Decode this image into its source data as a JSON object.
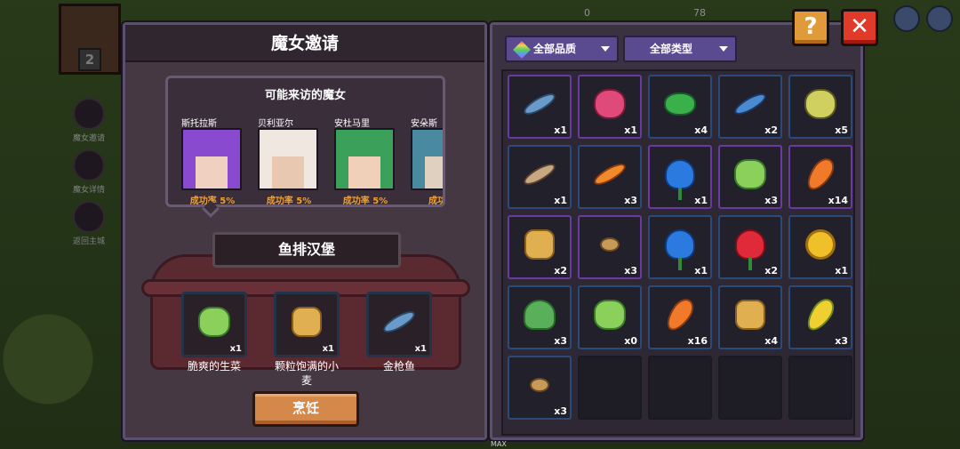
{
  "window": {
    "title": "魔女邀请"
  },
  "side_menu": [
    {
      "label": "魔女邀请",
      "icon": "heart-icon"
    },
    {
      "label": "魔女详情",
      "icon": "gift-icon"
    },
    {
      "label": "返回主城",
      "icon": "castle-icon"
    }
  ],
  "house_number": "2",
  "resources": {
    "count_a": "0",
    "count_b": "78"
  },
  "witch_section": {
    "title": "可能来访的魔女",
    "witches": [
      {
        "name": "斯托拉斯",
        "rate": "成功率 5%",
        "hair": "#8a4ad0",
        "skin": "#f0d0c0"
      },
      {
        "name": "贝利亚尔",
        "rate": "成功率 5%",
        "hair": "#f0e8e0",
        "skin": "#e8c8b0"
      },
      {
        "name": "安杜马里",
        "rate": "成功率 5%",
        "hair": "#3aa05a",
        "skin": "#f0d0b8"
      },
      {
        "name": "安朵斯",
        "rate": "成功率",
        "hair": "#4a8aa0",
        "skin": "#e0d0c0"
      }
    ]
  },
  "dish": {
    "name": "鱼排汉堡"
  },
  "ingredients": [
    {
      "label": "脆爽的生菜",
      "count": "x1",
      "icon": "lettuce-icon"
    },
    {
      "label": "颗粒饱满的小麦",
      "count": "x1",
      "icon": "wheat-icon"
    },
    {
      "label": "金枪鱼",
      "count": "x1",
      "icon": "tuna-icon"
    }
  ],
  "cook_button": {
    "label": "烹饪"
  },
  "filters": {
    "quality": "全部品质",
    "type": "全部类型"
  },
  "inventory": [
    {
      "icon": "tuna-icon",
      "count": "x1",
      "quality": "purple"
    },
    {
      "icon": "octopus-icon",
      "count": "x1",
      "quality": "purple"
    },
    {
      "icon": "frog-icon",
      "count": "x4",
      "quality": "blue"
    },
    {
      "icon": "blue-fish-icon",
      "count": "x2",
      "quality": "blue"
    },
    {
      "icon": "pufferfish-icon",
      "count": "x5",
      "quality": "blue"
    },
    {
      "icon": "catfish-icon",
      "count": "x1",
      "quality": "blue"
    },
    {
      "icon": "goldfish-icon",
      "count": "x3",
      "quality": "blue"
    },
    {
      "icon": "blue-rose-icon",
      "count": "x1",
      "quality": "purple"
    },
    {
      "icon": "lettuce-icon",
      "count": "x3",
      "quality": "purple"
    },
    {
      "icon": "carrot-icon",
      "count": "x14",
      "quality": "purple"
    },
    {
      "icon": "wheat-icon",
      "count": "x2",
      "quality": "purple"
    },
    {
      "icon": "potato-icon",
      "count": "x3",
      "quality": "purple"
    },
    {
      "icon": "blue-rose-icon",
      "count": "x1",
      "quality": "blue"
    },
    {
      "icon": "red-rose-icon",
      "count": "x2",
      "quality": "blue"
    },
    {
      "icon": "sunflower-icon",
      "count": "x1",
      "quality": "blue"
    },
    {
      "icon": "bok-choy-icon",
      "count": "x3",
      "quality": "blue"
    },
    {
      "icon": "lettuce-icon",
      "count": "x0",
      "quality": "blue"
    },
    {
      "icon": "carrot-icon",
      "count": "x16",
      "quality": "blue"
    },
    {
      "icon": "wheat-icon",
      "count": "x4",
      "quality": "blue"
    },
    {
      "icon": "corn-icon",
      "count": "x3",
      "quality": "blue"
    },
    {
      "icon": "potato-icon",
      "count": "x3",
      "quality": "blue"
    },
    {
      "icon": "",
      "count": "",
      "quality": "empty"
    },
    {
      "icon": "",
      "count": "",
      "quality": "empty"
    },
    {
      "icon": "",
      "count": "",
      "quality": "empty"
    },
    {
      "icon": "",
      "count": "",
      "quality": "empty"
    }
  ],
  "top_buttons": {
    "help": "?",
    "close": "✕"
  },
  "footer": {
    "max_label": "MAX"
  }
}
